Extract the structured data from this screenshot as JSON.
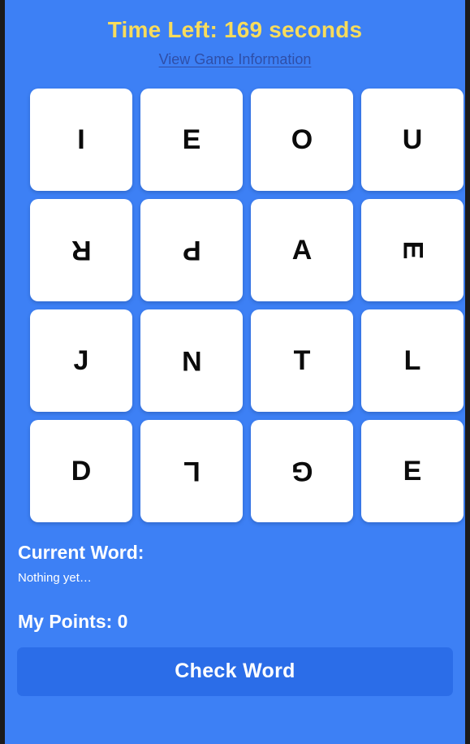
{
  "header": {
    "timer_label": "Time Left: 169 seconds",
    "timer_seconds": 169,
    "info_link": "View Game Information",
    "timer_color": "#f7dc5c",
    "link_color": "#2f4fa8"
  },
  "board": {
    "rows": 4,
    "cols": 4,
    "tiles": [
      {
        "letter": "I",
        "rotation": 0
      },
      {
        "letter": "E",
        "rotation": 0
      },
      {
        "letter": "O",
        "rotation": 0
      },
      {
        "letter": "U",
        "rotation": 0
      },
      {
        "letter": "R",
        "rotation": 180
      },
      {
        "letter": "P",
        "rotation": 180
      },
      {
        "letter": "A",
        "rotation": 0
      },
      {
        "letter": "E",
        "rotation": 90
      },
      {
        "letter": "J",
        "rotation": 0
      },
      {
        "letter": "N",
        "rotation": 180
      },
      {
        "letter": "T",
        "rotation": 0
      },
      {
        "letter": "L",
        "rotation": 0
      },
      {
        "letter": "D",
        "rotation": 0
      },
      {
        "letter": "L",
        "rotation": 180
      },
      {
        "letter": "G",
        "rotation": 180
      },
      {
        "letter": "E",
        "rotation": 0
      }
    ]
  },
  "status": {
    "current_word_heading": "Current Word:",
    "current_word_value": "Nothing yet…",
    "points_label": "My Points: 0",
    "points_value": 0
  },
  "actions": {
    "check_word_label": "Check Word"
  },
  "theme": {
    "background": "#3d80f5",
    "tile_background": "#ffffff",
    "tile_letter": "#0b0b0b",
    "button_background": "#2b6de8",
    "button_text": "#ffffff",
    "text": "#ffffff"
  }
}
